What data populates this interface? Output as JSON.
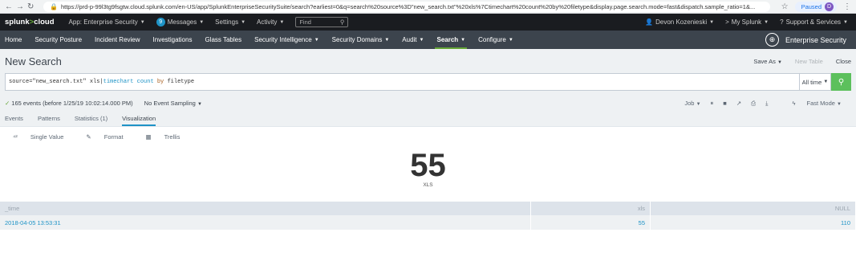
{
  "browser": {
    "url": "https://prd-p-99l3tg9fsgtw.cloud.splunk.com/en-US/app/SplunkEnterpriseSecuritySuite/search?earliest=0&q=search%20source%3D\"new_search.txt\"%20xls%7Ctimechart%20count%20by%20filetype&display.page.search.mode=fast&dispatch.sample_ratio=1&...",
    "paused_label": "Paused",
    "profile_initial": "D"
  },
  "topbar": {
    "logo_a": "splunk",
    "logo_gt": ">",
    "logo_b": "cloud",
    "app_label": "App: Enterprise Security",
    "messages_count": "9",
    "messages_label": "Messages",
    "settings_label": "Settings",
    "activity_label": "Activity",
    "find_placeholder": "Find",
    "user_label": "Devon Kozenieski",
    "mysplunk_label": "My Splunk",
    "support_label": "Support & Services"
  },
  "appnav": {
    "items": [
      {
        "label": "Home"
      },
      {
        "label": "Security Posture"
      },
      {
        "label": "Incident Review"
      },
      {
        "label": "Investigations"
      },
      {
        "label": "Glass Tables"
      },
      {
        "label": "Security Intelligence"
      },
      {
        "label": "Security Domains"
      },
      {
        "label": "Audit"
      },
      {
        "label": "Search"
      },
      {
        "label": "Configure"
      }
    ],
    "brand": "Enterprise Security"
  },
  "page": {
    "title": "New Search",
    "save_as": "Save As",
    "new_table": "New Table",
    "close": "Close"
  },
  "search": {
    "q_source": "source=\"new_search.txt\" xls|",
    "q_cmd": "timechart",
    "q_count": "count",
    "q_by": "by",
    "q_field": "filetype",
    "time_label": "All time"
  },
  "status": {
    "events": "165 events (before 1/25/19 10:02:14.000 PM)",
    "sampling": "No Event Sampling",
    "job": "Job",
    "mode": "Fast Mode"
  },
  "tabs": [
    {
      "label": "Events"
    },
    {
      "label": "Patterns"
    },
    {
      "label": "Statistics (1)"
    },
    {
      "label": "Visualization"
    }
  ],
  "viz": {
    "single_value": "Single Value",
    "format": "Format",
    "trellis": "Trellis",
    "value": "55",
    "under_label": "XLS"
  },
  "table": {
    "headers": [
      "_time",
      "xls",
      "NULL"
    ],
    "rows": [
      [
        "2018-04-05 13:53:31",
        "55",
        "110"
      ]
    ]
  }
}
